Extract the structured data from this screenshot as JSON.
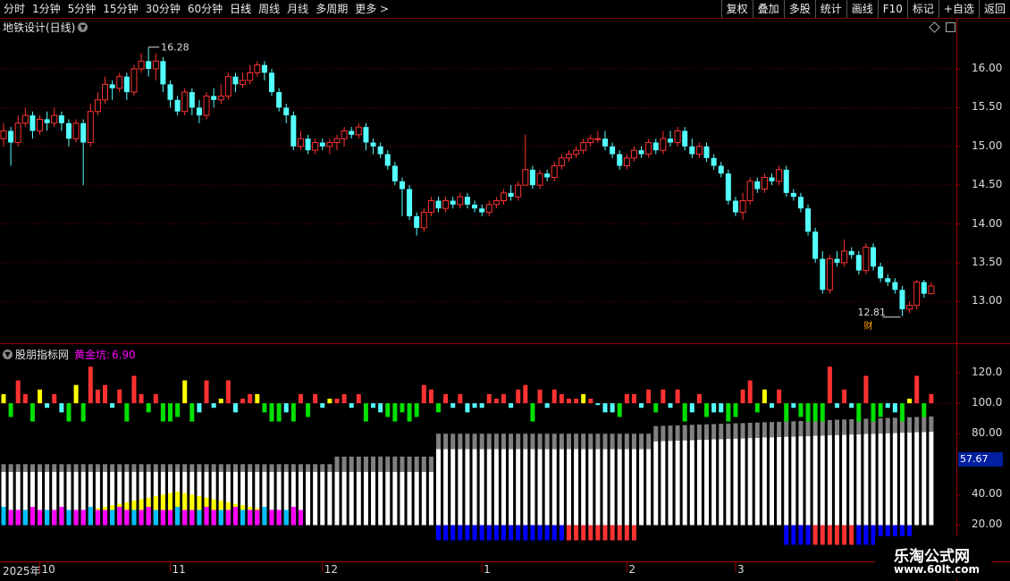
{
  "toolbar": {
    "periods": [
      "分时",
      "1分钟",
      "5分钟",
      "15分钟",
      "30分钟",
      "60分钟",
      "日线",
      "周线",
      "月线",
      "多周期",
      "更多 >"
    ],
    "active": "日线",
    "buttons": [
      "复权",
      "叠加",
      "多股",
      "统计",
      "画线",
      "F10",
      "标记",
      "+自选",
      "返回"
    ]
  },
  "chart_title": "地铁设计(日线)",
  "indicator": {
    "name": "股朋指标网",
    "label": "黄金坑:",
    "value": "6.90"
  },
  "price_axis": [
    "16.00",
    "15.50",
    "15.00",
    "14.50",
    "14.00",
    "13.50",
    "13.00"
  ],
  "indicator_axis": [
    "120.0",
    "100.0",
    "80.00",
    "40.00",
    "20.00"
  ],
  "indicator_readout": "57.67",
  "high_marker": "16.28",
  "low_marker": "12.81",
  "event_tag": "财",
  "time_axis": {
    "year": "2025年",
    "months": [
      "10",
      "11",
      "12",
      "1",
      "2",
      "3"
    ]
  },
  "watermark": {
    "line1": "乐淘公式网",
    "line2": "www.60lt.com"
  },
  "colors": {
    "up": "#ff3232",
    "down": "#54ffff",
    "grid": "#800000",
    "yellow": "#ffff00",
    "magenta": "#ff00ff",
    "cyan": "#00c0ff",
    "green": "#00e000",
    "blue": "#0000ff",
    "gray": "#808080",
    "white": "#ffffff"
  },
  "chart_data": {
    "type": "candlestick",
    "ylim": [
      12.6,
      16.45
    ],
    "candles": [
      [
        15.1,
        15.2,
        15.3,
        15.0
      ],
      [
        15.2,
        15.05,
        15.25,
        14.75
      ],
      [
        15.05,
        15.3,
        15.4,
        15.0
      ],
      [
        15.3,
        15.4,
        15.5,
        15.25
      ],
      [
        15.4,
        15.2,
        15.45,
        15.1
      ],
      [
        15.2,
        15.35,
        15.4,
        15.15
      ],
      [
        15.35,
        15.3,
        15.45,
        15.2
      ],
      [
        15.3,
        15.4,
        15.5,
        15.25
      ],
      [
        15.4,
        15.3,
        15.45,
        15.2
      ],
      [
        15.3,
        15.1,
        15.35,
        15.0
      ],
      [
        15.1,
        15.3,
        15.35,
        15.05
      ],
      [
        15.3,
        15.05,
        15.35,
        14.5
      ],
      [
        15.05,
        15.45,
        15.55,
        15.0
      ],
      [
        15.45,
        15.6,
        15.7,
        15.4
      ],
      [
        15.6,
        15.8,
        15.9,
        15.55
      ],
      [
        15.8,
        15.75,
        15.85,
        15.6
      ],
      [
        15.75,
        15.9,
        15.95,
        15.7
      ],
      [
        15.9,
        15.7,
        15.95,
        15.6
      ],
      [
        15.7,
        16.0,
        16.05,
        15.65
      ],
      [
        16.0,
        16.1,
        16.2,
        15.95
      ],
      [
        16.1,
        16.0,
        16.28,
        15.9
      ],
      [
        16.0,
        16.1,
        16.2,
        15.85
      ],
      [
        16.1,
        15.8,
        16.15,
        15.7
      ],
      [
        15.8,
        15.6,
        15.85,
        15.5
      ],
      [
        15.6,
        15.45,
        15.65,
        15.4
      ],
      [
        15.45,
        15.7,
        15.75,
        15.4
      ],
      [
        15.7,
        15.5,
        15.75,
        15.4
      ],
      [
        15.5,
        15.4,
        15.6,
        15.3
      ],
      [
        15.4,
        15.65,
        15.7,
        15.35
      ],
      [
        15.65,
        15.6,
        15.75,
        15.5
      ],
      [
        15.6,
        15.65,
        15.8,
        15.55
      ],
      [
        15.65,
        15.9,
        15.95,
        15.6
      ],
      [
        15.9,
        15.8,
        15.95,
        15.7
      ],
      [
        15.8,
        15.85,
        15.95,
        15.75
      ],
      [
        15.85,
        15.95,
        16.05,
        15.8
      ],
      [
        15.95,
        16.05,
        16.1,
        15.9
      ],
      [
        16.05,
        15.95,
        16.1,
        15.85
      ],
      [
        15.95,
        15.7,
        16.0,
        15.65
      ],
      [
        15.7,
        15.5,
        15.75,
        15.45
      ],
      [
        15.5,
        15.4,
        15.55,
        15.3
      ],
      [
        15.4,
        15.0,
        15.45,
        14.95
      ],
      [
        15.0,
        15.1,
        15.2,
        14.95
      ],
      [
        15.1,
        14.95,
        15.15,
        14.9
      ],
      [
        14.95,
        15.05,
        15.1,
        14.9
      ],
      [
        15.05,
        15.0,
        15.1,
        14.95
      ],
      [
        15.0,
        15.05,
        15.1,
        14.9
      ],
      [
        15.05,
        15.1,
        15.15,
        14.95
      ],
      [
        15.1,
        15.2,
        15.25,
        15.0
      ],
      [
        15.2,
        15.15,
        15.25,
        15.1
      ],
      [
        15.15,
        15.25,
        15.3,
        15.1
      ],
      [
        15.25,
        15.05,
        15.3,
        14.95
      ],
      [
        15.05,
        15.0,
        15.1,
        14.9
      ],
      [
        15.0,
        14.9,
        15.05,
        14.85
      ],
      [
        14.9,
        14.75,
        14.95,
        14.7
      ],
      [
        14.75,
        14.55,
        14.8,
        14.5
      ],
      [
        14.55,
        14.45,
        14.6,
        14.1
      ],
      [
        14.45,
        14.1,
        14.5,
        14.05
      ],
      [
        14.1,
        13.95,
        14.15,
        13.85
      ],
      [
        13.95,
        14.15,
        14.2,
        13.9
      ],
      [
        14.15,
        14.3,
        14.35,
        14.1
      ],
      [
        14.3,
        14.2,
        14.35,
        14.15
      ],
      [
        14.2,
        14.3,
        14.35,
        14.15
      ],
      [
        14.3,
        14.25,
        14.35,
        14.2
      ],
      [
        14.25,
        14.35,
        14.4,
        14.2
      ],
      [
        14.35,
        14.25,
        14.4,
        14.2
      ],
      [
        14.25,
        14.2,
        14.3,
        14.15
      ],
      [
        14.2,
        14.15,
        14.25,
        14.1
      ],
      [
        14.15,
        14.25,
        14.3,
        14.1
      ],
      [
        14.25,
        14.3,
        14.35,
        14.2
      ],
      [
        14.3,
        14.4,
        14.45,
        14.25
      ],
      [
        14.4,
        14.35,
        14.5,
        14.3
      ],
      [
        14.35,
        14.5,
        14.55,
        14.3
      ],
      [
        14.5,
        14.7,
        15.15,
        14.5
      ],
      [
        14.7,
        14.5,
        14.75,
        14.45
      ],
      [
        14.5,
        14.65,
        14.7,
        14.45
      ],
      [
        14.65,
        14.6,
        14.7,
        14.55
      ],
      [
        14.6,
        14.75,
        14.8,
        14.55
      ],
      [
        14.75,
        14.85,
        14.9,
        14.7
      ],
      [
        14.85,
        14.9,
        14.95,
        14.8
      ],
      [
        14.9,
        14.95,
        15.0,
        14.85
      ],
      [
        14.95,
        15.05,
        15.1,
        14.9
      ],
      [
        15.05,
        15.1,
        15.15,
        15.0
      ],
      [
        15.1,
        15.1,
        15.2,
        15.05
      ],
      [
        15.1,
        15.0,
        15.2,
        14.95
      ],
      [
        15.0,
        14.9,
        15.05,
        14.85
      ],
      [
        14.9,
        14.75,
        14.95,
        14.7
      ],
      [
        14.75,
        14.85,
        14.9,
        14.7
      ],
      [
        14.85,
        14.95,
        15.0,
        14.8
      ],
      [
        14.95,
        14.9,
        15.0,
        14.85
      ],
      [
        14.9,
        15.05,
        15.1,
        14.85
      ],
      [
        15.05,
        14.95,
        15.1,
        14.9
      ],
      [
        14.95,
        15.1,
        15.2,
        14.9
      ],
      [
        15.1,
        15.05,
        15.2,
        15.0
      ],
      [
        15.05,
        15.2,
        15.25,
        15.0
      ],
      [
        15.2,
        15.0,
        15.25,
        14.95
      ],
      [
        15.0,
        14.9,
        15.1,
        14.85
      ],
      [
        14.9,
        15.0,
        15.05,
        14.85
      ],
      [
        15.0,
        14.85,
        15.05,
        14.8
      ],
      [
        14.85,
        14.75,
        14.9,
        14.7
      ],
      [
        14.75,
        14.65,
        14.8,
        14.6
      ],
      [
        14.65,
        14.3,
        14.7,
        14.25
      ],
      [
        14.3,
        14.15,
        14.35,
        14.1
      ],
      [
        14.15,
        14.3,
        14.4,
        14.05
      ],
      [
        14.3,
        14.55,
        14.6,
        14.25
      ],
      [
        14.55,
        14.45,
        14.6,
        14.4
      ],
      [
        14.45,
        14.6,
        14.65,
        14.4
      ],
      [
        14.6,
        14.55,
        14.65,
        14.5
      ],
      [
        14.55,
        14.7,
        14.75,
        14.5
      ],
      [
        14.7,
        14.4,
        14.75,
        14.35
      ],
      [
        14.4,
        14.35,
        14.45,
        14.3
      ],
      [
        14.35,
        14.2,
        14.4,
        14.15
      ],
      [
        14.2,
        13.9,
        14.25,
        13.85
      ],
      [
        13.9,
        13.55,
        13.95,
        13.5
      ],
      [
        13.55,
        13.15,
        13.65,
        13.1
      ],
      [
        13.15,
        13.55,
        13.6,
        13.1
      ],
      [
        13.55,
        13.5,
        13.65,
        13.45
      ],
      [
        13.5,
        13.65,
        13.8,
        13.45
      ],
      [
        13.65,
        13.6,
        13.7,
        13.55
      ],
      [
        13.6,
        13.4,
        13.65,
        13.35
      ],
      [
        13.4,
        13.7,
        13.75,
        13.35
      ],
      [
        13.7,
        13.45,
        13.75,
        13.4
      ],
      [
        13.45,
        13.3,
        13.5,
        13.25
      ],
      [
        13.3,
        13.25,
        13.35,
        13.2
      ],
      [
        13.25,
        13.15,
        13.3,
        13.1
      ],
      [
        13.15,
        12.9,
        13.2,
        12.81
      ],
      [
        12.9,
        12.95,
        13.0,
        12.85
      ],
      [
        12.95,
        13.25,
        13.28,
        12.9
      ],
      [
        13.25,
        13.1,
        13.28,
        13.05
      ],
      [
        13.1,
        13.2,
        13.25,
        13.15
      ]
    ],
    "indicator": {
      "ylim": [
        15,
        130
      ],
      "bars": [
        [
          22,
          30,
          "up"
        ],
        [
          22,
          30,
          "up"
        ],
        [
          28,
          24,
          "up"
        ],
        [
          28,
          24,
          "up"
        ],
        [
          28,
          18,
          "up"
        ],
        [
          35,
          16,
          "up"
        ],
        [
          40,
          14,
          "up"
        ],
        [
          42,
          12,
          "up"
        ],
        [
          43,
          12,
          "up"
        ],
        [
          43,
          13,
          "up"
        ],
        [
          43,
          14,
          "up"
        ],
        [
          42,
          16,
          "up"
        ],
        [
          44,
          18,
          "up"
        ],
        [
          45,
          20,
          "up"
        ],
        [
          46,
          22,
          "up"
        ],
        [
          47,
          22,
          "up"
        ],
        [
          48,
          22,
          "up"
        ],
        [
          46,
          24,
          "up"
        ],
        [
          45,
          28,
          "up"
        ],
        [
          43,
          30,
          "up"
        ],
        [
          42,
          30,
          "up"
        ],
        [
          40,
          30,
          "up"
        ],
        [
          38,
          30,
          "up"
        ],
        [
          35,
          30,
          "up"
        ],
        [
          34,
          30,
          "up"
        ],
        [
          32,
          30,
          "up"
        ],
        [
          31,
          30,
          "up"
        ],
        [
          30,
          30,
          "up"
        ],
        [
          30,
          30,
          "up"
        ],
        [
          30,
          30,
          "up"
        ],
        [
          30,
          30,
          "up"
        ],
        [
          30,
          30,
          "up"
        ],
        [
          30,
          30,
          "up"
        ],
        [
          30,
          30,
          "up"
        ],
        [
          30,
          30,
          "up"
        ],
        [
          30,
          30,
          "up"
        ],
        [
          30,
          30,
          "up"
        ],
        [
          30,
          30,
          "up"
        ]
      ]
    }
  }
}
